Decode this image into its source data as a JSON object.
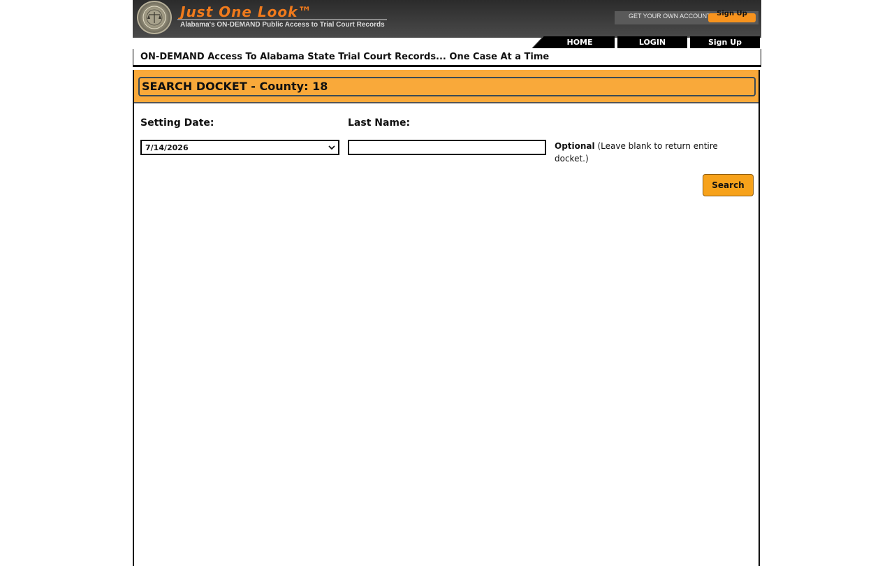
{
  "header": {
    "brand_title": "Just One Look™",
    "brand_subtitle": "Alabama's ON-DEMAND Public Access to Trial Court Records",
    "account_label": "GET YOUR OWN ACCOUNT",
    "account_button": "Sign Up"
  },
  "nav": {
    "items": [
      {
        "label": "HOME"
      },
      {
        "label": "LOGIN"
      },
      {
        "label": "Sign Up"
      }
    ]
  },
  "tagline": "ON-DEMAND Access To Alabama State Trial Court Records... One Case At a Time",
  "search": {
    "title": "SEARCH DOCKET - County: 18",
    "setting_date_label": "Setting Date:",
    "setting_date_value": "7/14/2026",
    "last_name_label": "Last Name:",
    "last_name_value": "",
    "optional_bold": "Optional",
    "optional_text": "(Leave blank to return entire docket.)",
    "search_button": "Search"
  },
  "colors": {
    "brand_orange": "#f07a1c",
    "banner_orange": "#f9a93a",
    "button_orange": "#f7a21b",
    "header_dark": "#3e3e3e"
  }
}
